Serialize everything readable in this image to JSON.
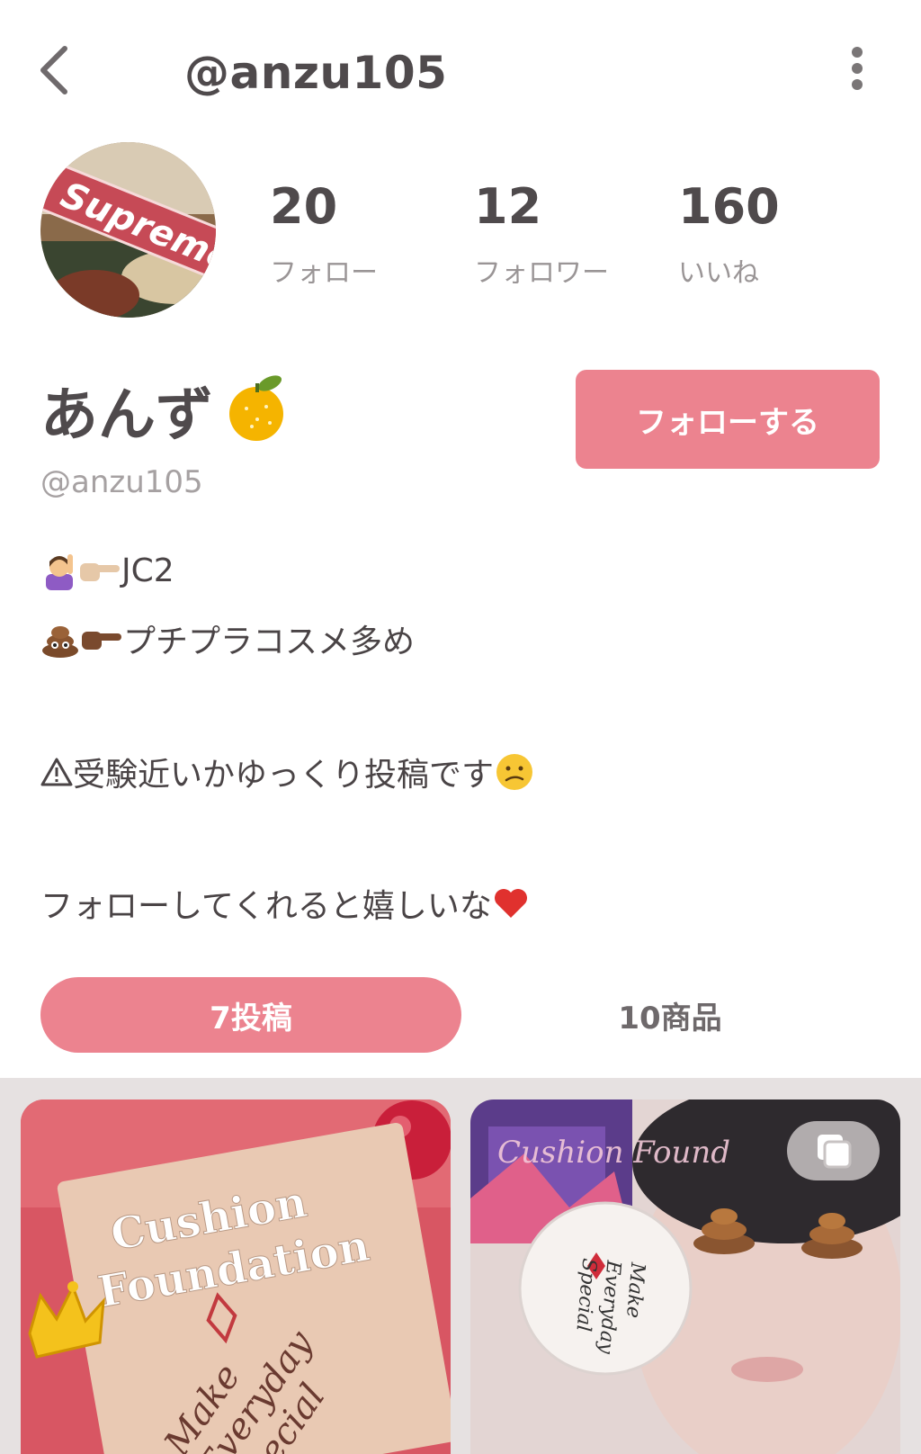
{
  "header": {
    "title": "@anzu105"
  },
  "profile": {
    "display_name": "あんず",
    "handle": "@anzu105",
    "follow_button": "フォローする"
  },
  "stats": [
    {
      "value": "20",
      "label": "フォロー"
    },
    {
      "value": "12",
      "label": "フォロワー"
    },
    {
      "value": "160",
      "label": "いいね"
    }
  ],
  "bio": {
    "line1": "JC2",
    "line2": "プチプラコスメ多め",
    "line3": "受験近いかゆっくり投稿です",
    "line4": "フォローしてくれると嬉しいな"
  },
  "tabs": {
    "posts": "7投稿",
    "products": "10商品"
  },
  "avatar": {
    "text": "Supreme"
  },
  "posts": [
    {
      "title_lines": [
        "Cushion",
        "Foundation"
      ],
      "script_lines": [
        "Make",
        "Everyday",
        "Special"
      ]
    },
    {
      "title": "Cushion Found",
      "script_lines": [
        "Make",
        "Everyday",
        "Special"
      ]
    }
  ],
  "colors": {
    "accent": "#ec838f",
    "text": "#4a4446",
    "muted": "#a6a1a2",
    "grid_bg": "#e6e1e1"
  },
  "icons": [
    "back-chevron-icon",
    "more-vertical-icon",
    "tangerine-emoji-icon",
    "raising-hand-emoji-icon",
    "pointing-right-emoji-icon",
    "poop-emoji-icon",
    "warning-icon",
    "confused-face-emoji-icon",
    "red-heart-emoji-icon",
    "crown-icon",
    "multiple-images-icon"
  ]
}
